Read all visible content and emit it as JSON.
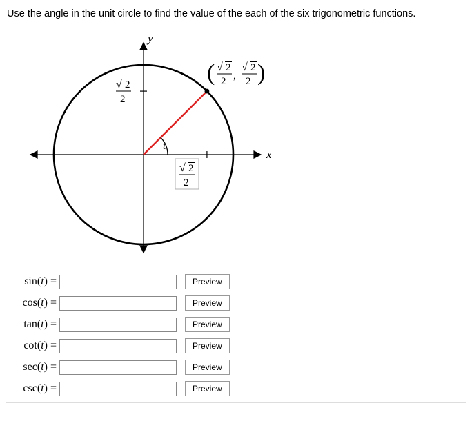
{
  "instruction": "Use the angle in the unit circle to find the value of the each of the six trigonometric functions.",
  "diagram": {
    "axis_x": "x",
    "axis_y": "y",
    "angle_label": "t",
    "point_label": "(√2/2 , √2/2)",
    "x_tick": "√2/2",
    "y_tick": "√2/2"
  },
  "functions": [
    {
      "name": "sin",
      "arg": "t"
    },
    {
      "name": "cos",
      "arg": "t"
    },
    {
      "name": "tan",
      "arg": "t"
    },
    {
      "name": "cot",
      "arg": "t"
    },
    {
      "name": "sec",
      "arg": "t"
    },
    {
      "name": "csc",
      "arg": "t"
    }
  ],
  "preview_label": "Preview",
  "chart_data": {
    "type": "diagram",
    "description": "Unit circle centered at origin with radius 1. Angle t in standard position with terminal side at 45 degrees hitting point (√2/2, √2/2). Coordinate tick marks at √2/2 on both positive x and positive y axes.",
    "point": {
      "x": "√2/2",
      "y": "√2/2"
    },
    "angle_deg_approx": 45
  }
}
